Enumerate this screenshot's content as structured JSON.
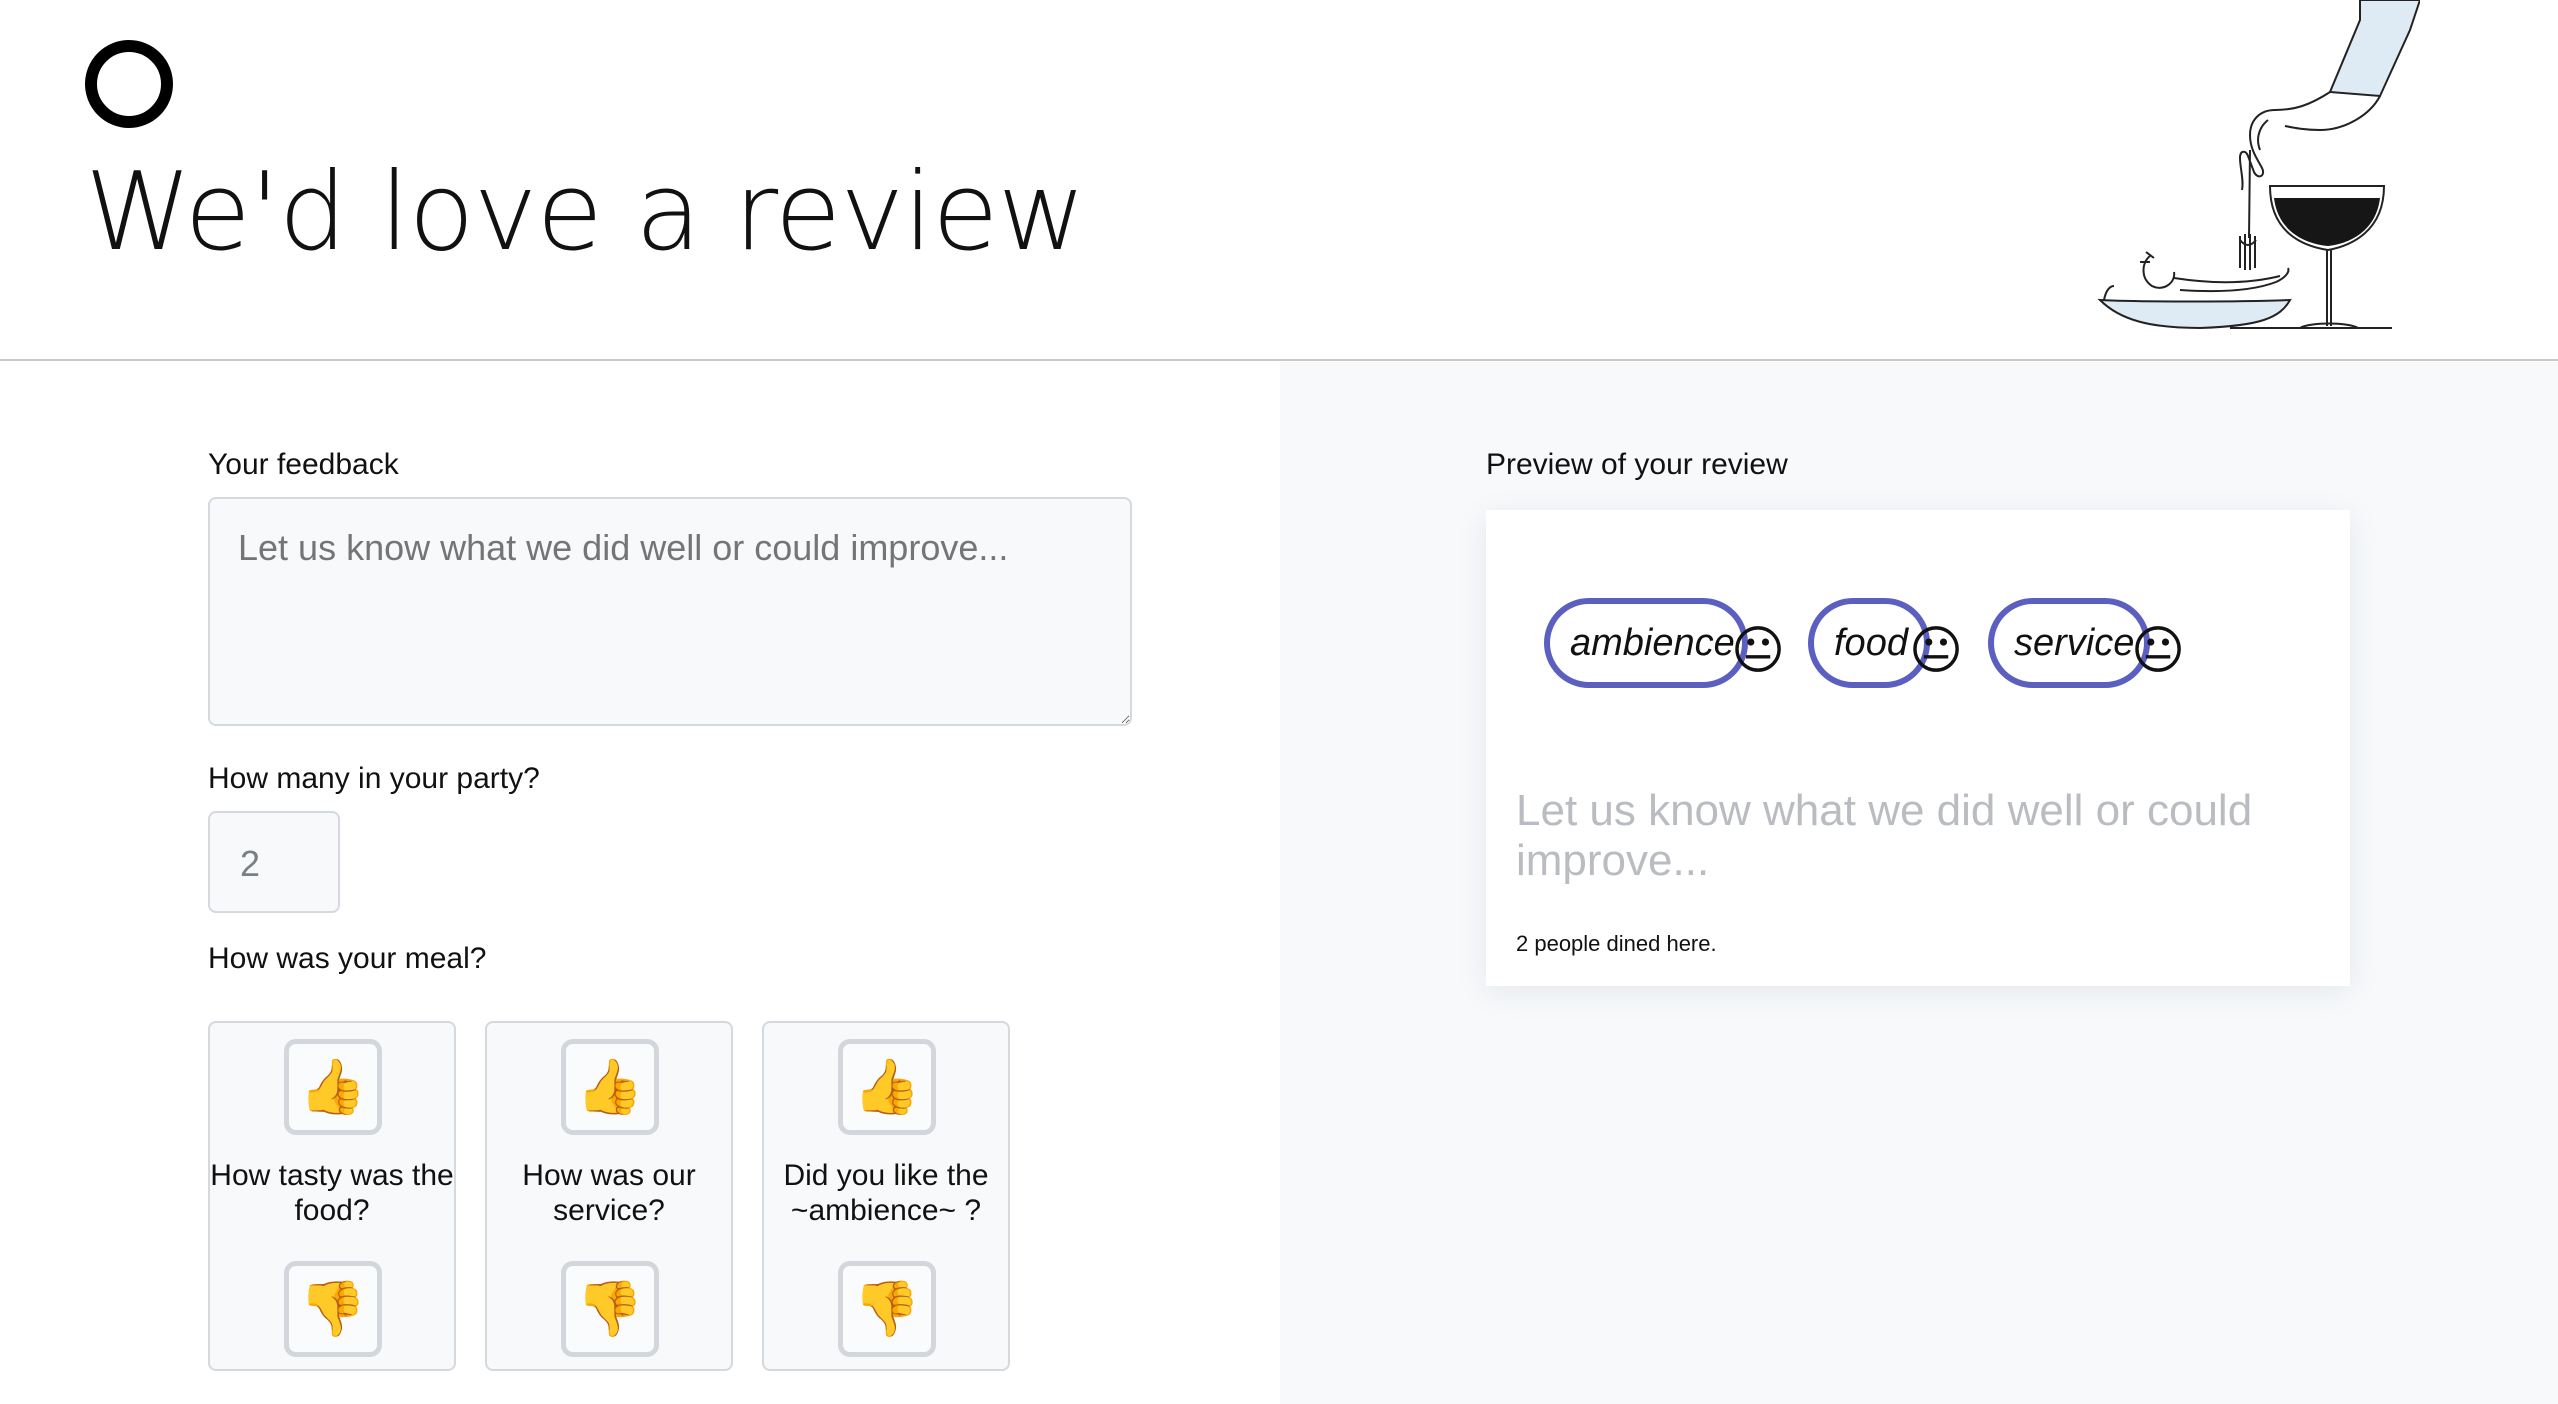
{
  "header": {
    "title": "We'd love a review",
    "logo_icon": "ring-logo-icon",
    "illustration_icon": "dining-hand-fork-glass-illustration"
  },
  "form": {
    "feedback_label": "Your feedback",
    "feedback_placeholder": "Let us know what we did well or could improve...",
    "feedback_value": "",
    "party_label": "How many in your party?",
    "party_value": "2",
    "meal_label": "How was your meal?",
    "meal_cards": [
      {
        "question": "How tasty was the food?",
        "up_icon": "👍",
        "down_icon": "👎"
      },
      {
        "question": "How was our service?",
        "up_icon": "👍",
        "down_icon": "👎"
      },
      {
        "question": "Did you like the ~ambience~ ?",
        "up_icon": "👍",
        "down_icon": "👎"
      }
    ]
  },
  "preview": {
    "label": "Preview of your review",
    "tags": [
      {
        "label": "ambience",
        "emoji": "😐"
      },
      {
        "label": "food",
        "emoji": "😐"
      },
      {
        "label": "service",
        "emoji": "😐"
      }
    ],
    "text": "Let us know what we did well or could improve...",
    "footer": "2 people dined here."
  },
  "colors": {
    "accent": "#5b5fbf",
    "panel_bg": "#f7f9fb",
    "border": "#d5d9de"
  }
}
